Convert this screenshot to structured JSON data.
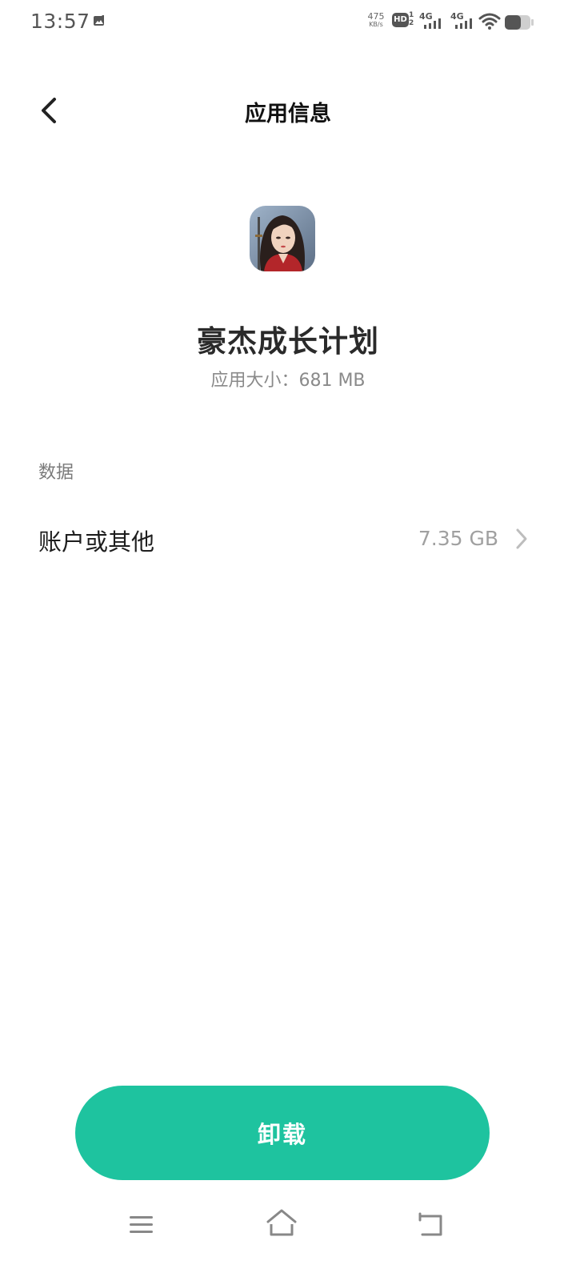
{
  "status_bar": {
    "time": "13:57",
    "net_speed_value": "475",
    "net_speed_unit": "KB/s",
    "hd_label": "HD",
    "hd_sub": "1\n2",
    "signal1_label": "4G",
    "signal2_label": "4G",
    "icons": [
      "image-notification-icon",
      "hd-icon",
      "signal-4g-icon",
      "signal-4g-icon",
      "wifi-icon",
      "battery-icon"
    ]
  },
  "header": {
    "title": "应用信息",
    "back_icon": "chevron-left-icon"
  },
  "app": {
    "name": "豪杰成长计划",
    "size_label": "应用大小：",
    "size_value": "681 MB"
  },
  "data_section": {
    "label": "数据",
    "rows": [
      {
        "label": "账户或其他",
        "value": "7.35 GB"
      }
    ]
  },
  "actions": {
    "uninstall_label": "卸载",
    "accent_color": "#1ec39f"
  },
  "nav_bar": {
    "icons": [
      "menu-icon",
      "home-icon",
      "back-icon"
    ]
  }
}
